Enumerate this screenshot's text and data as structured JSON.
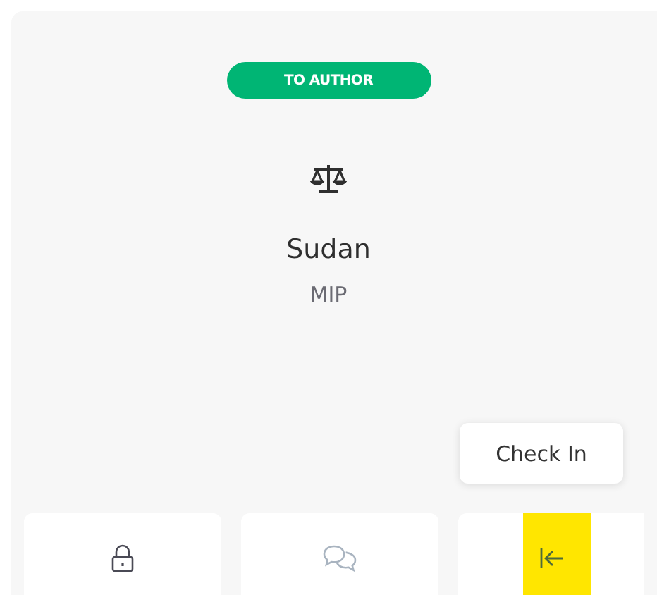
{
  "card": {
    "status_badge": "TO AUTHOR",
    "title": "Sudan",
    "subtitle": "MIP"
  },
  "tooltip": "Check In",
  "actions": [
    {
      "kind": "lock",
      "disabled": false,
      "highlighted": false
    },
    {
      "kind": "comments",
      "disabled": true,
      "highlighted": false
    },
    {
      "kind": "check-in",
      "disabled": false,
      "highlighted": true
    }
  ]
}
